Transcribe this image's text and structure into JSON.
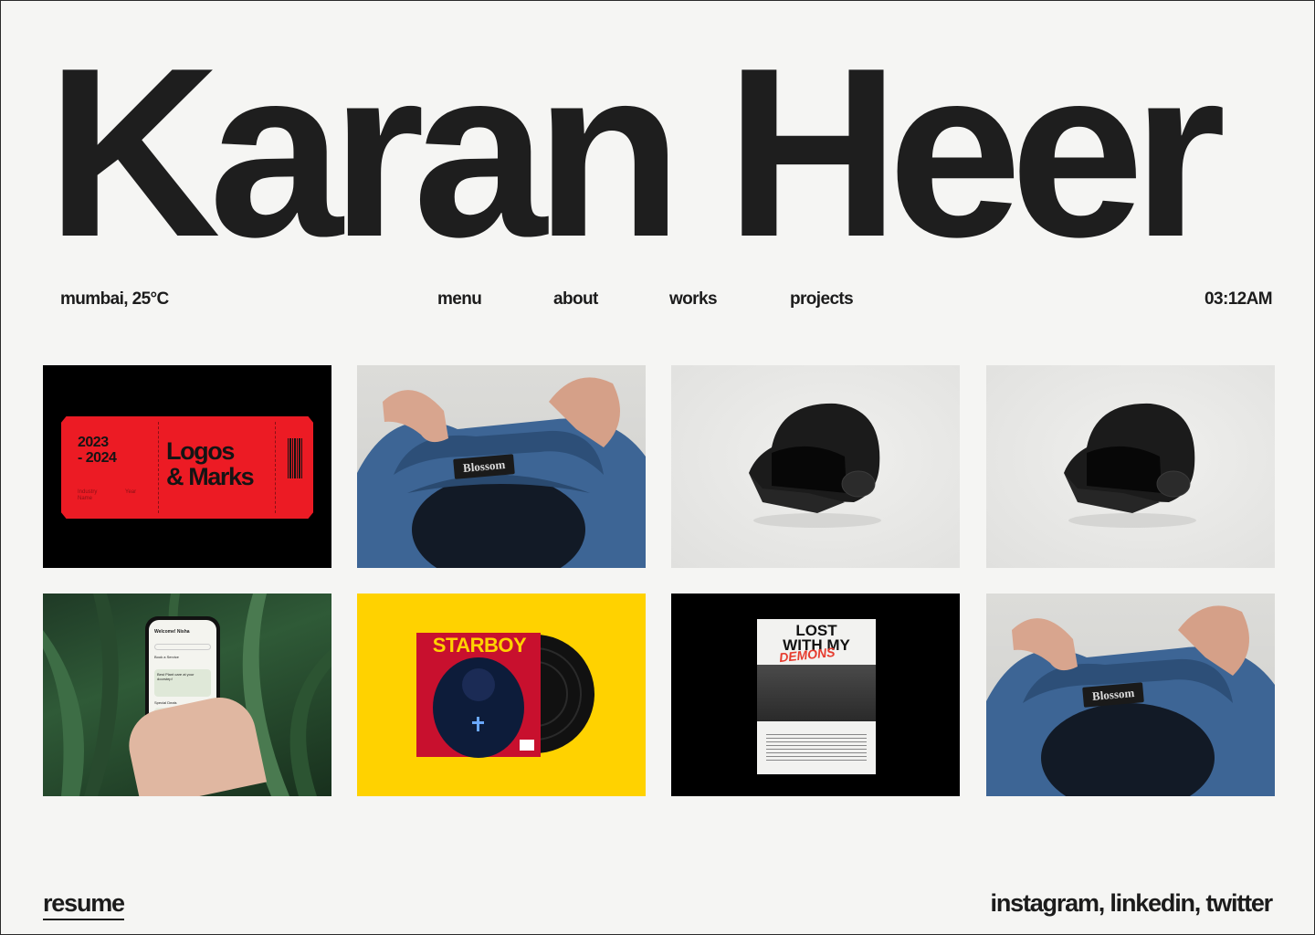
{
  "hero": {
    "title": "Karan Heer"
  },
  "nav": {
    "location": "mumbai, 25°C",
    "menu": "menu",
    "about": "about",
    "works": "works",
    "projects": "projects",
    "time": "03:12AM"
  },
  "tiles": {
    "logos": {
      "years": "2023\n- 2024",
      "title": "Logos\n& Marks",
      "small_a": "Industry\nName",
      "small_b": "Year"
    },
    "shirt_label": "Blossom",
    "app": {
      "greeting": "Welcome! Nisha",
      "card": "Best Plant care at your doorstep!",
      "section_a": "Book a Service",
      "section_b": "Special Deals"
    },
    "album": {
      "title": "STARBOY"
    },
    "poster": {
      "line1": "LOST",
      "line2": "WITH MY",
      "line3": "DEMONS"
    }
  },
  "colors": {
    "background": "#f5f5f3",
    "text": "#1c1c1c",
    "ticket_red": "#ec1b24",
    "starboy_yellow": "#ffd200"
  },
  "footer": {
    "resume": "resume",
    "socials": "instagram, linkedin, twitter"
  }
}
